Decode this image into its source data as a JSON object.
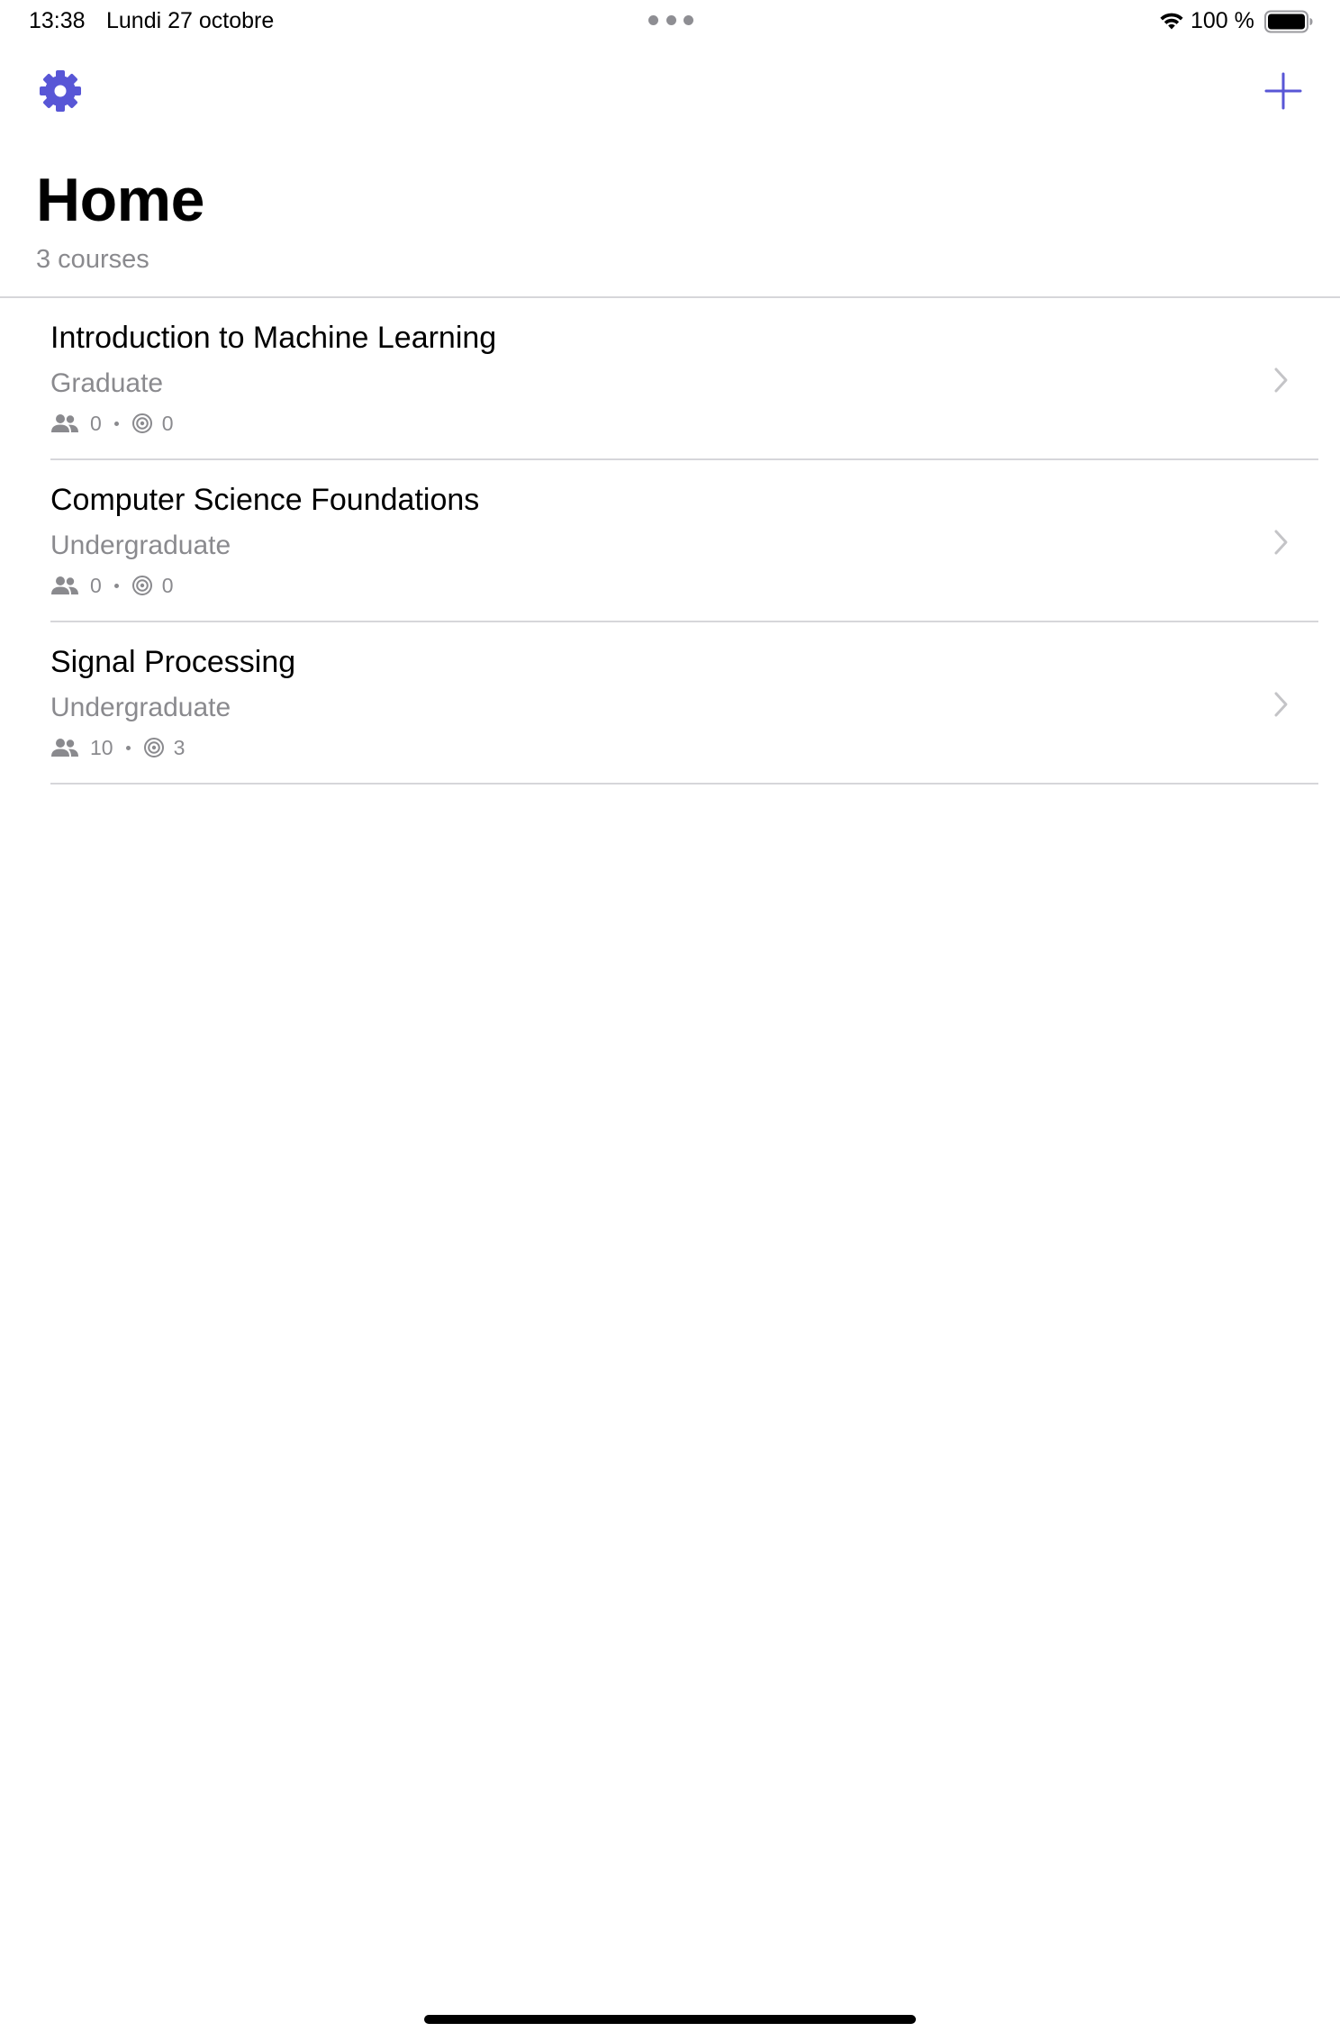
{
  "status_bar": {
    "time": "13:38",
    "date": "Lundi 27 octobre",
    "battery_text": "100 %",
    "wifi_icon": "wifi-icon",
    "battery_icon": "battery-full-icon"
  },
  "nav": {
    "settings_icon": "gear-icon",
    "add_icon": "plus-icon",
    "accent_color": "#5856d6"
  },
  "header": {
    "title": "Home",
    "subtitle": "3 courses"
  },
  "courses": [
    {
      "title": "Introduction to Machine Learning",
      "level": "Graduate",
      "students": "0",
      "targets": "0"
    },
    {
      "title": "Computer Science Foundations",
      "level": "Undergraduate",
      "students": "0",
      "targets": "0"
    },
    {
      "title": "Signal Processing",
      "level": "Undergraduate",
      "students": "10",
      "targets": "3"
    }
  ],
  "colors": {
    "secondary_text": "#8a8a8e",
    "divider": "#d6d6da",
    "chevron": "#c4c4c7"
  }
}
